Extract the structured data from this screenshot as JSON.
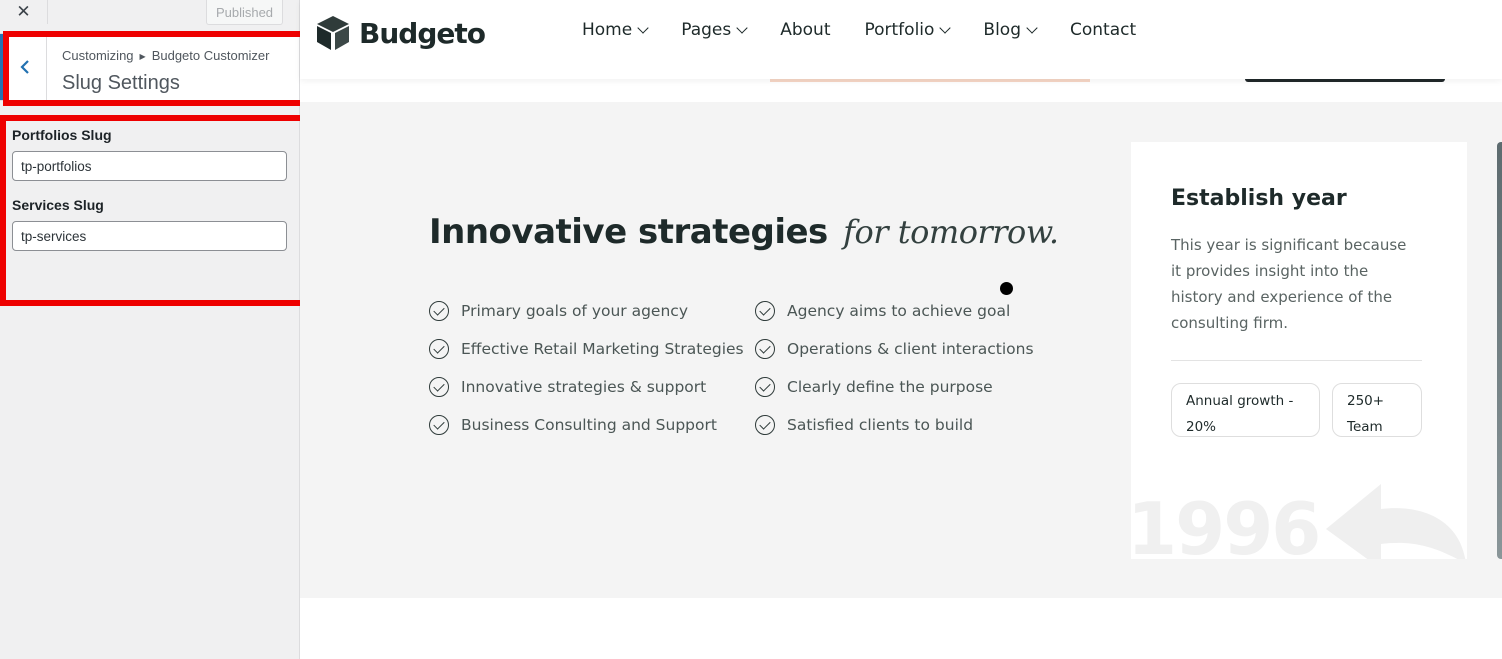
{
  "customizer": {
    "close_icon": "close-icon",
    "publish_label": "Published",
    "breadcrumb": [
      "Customizing",
      "Budgeto Customizer"
    ],
    "section_title": "Slug Settings",
    "fields": [
      {
        "label": "Portfolios Slug",
        "value": "tp-portfolios"
      },
      {
        "label": "Services Slug",
        "value": "tp-services"
      }
    ]
  },
  "site": {
    "logo_text": "Budgeto",
    "nav": [
      {
        "label": "Home",
        "has_dropdown": true
      },
      {
        "label": "Pages",
        "has_dropdown": true
      },
      {
        "label": "About",
        "has_dropdown": false
      },
      {
        "label": "Portfolio",
        "has_dropdown": true
      },
      {
        "label": "Blog",
        "has_dropdown": true
      },
      {
        "label": "Contact",
        "has_dropdown": false
      }
    ],
    "headline": {
      "main": "Innovative strategies",
      "accent": "for tomorrow."
    },
    "features_left": [
      "Primary goals of your agency",
      "Effective Retail Marketing Strategies",
      "Innovative strategies & support",
      "Business Consulting and Support"
    ],
    "features_right": [
      "Agency aims to achieve goal",
      "Operations & client interactions",
      "Clearly define the purpose",
      "Satisfied clients to build"
    ],
    "card": {
      "title": "Establish year",
      "description": "This year is significant because it provides insight into the history and experience of the consulting firm.",
      "pill_1": "Annual growth - 20%",
      "pill_2": "250+ Team",
      "year": "1996"
    }
  },
  "colors": {
    "highlight": "#ee0000",
    "wp_blue": "#2271b1",
    "dark_text": "#1e2a2a",
    "section_bg": "#f4f4f4"
  }
}
